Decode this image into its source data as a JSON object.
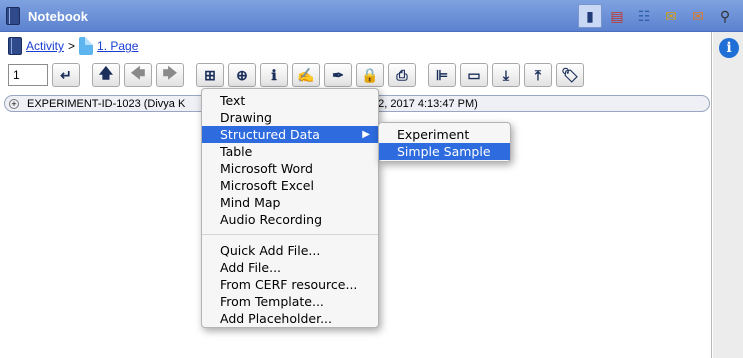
{
  "window": {
    "title": "Notebook"
  },
  "title_icons": [
    {
      "name": "notebook-view-icon",
      "glyph": "▮",
      "color": "#1f3b78"
    },
    {
      "name": "bookmark-page-icon",
      "glyph": "▤",
      "color": "#c0392b"
    },
    {
      "name": "table-list-icon",
      "glyph": "☷",
      "color": "#2e5fa8"
    },
    {
      "name": "envelope-icon",
      "glyph": "✉",
      "color": "#d4a017"
    },
    {
      "name": "open-envelope-icon",
      "glyph": "✉",
      "color": "#e07a1f"
    },
    {
      "name": "binoculars-icon",
      "glyph": "⚲",
      "color": "#333333"
    }
  ],
  "breadcrumb": {
    "activity": "Activity",
    "separator": ">",
    "page": "1. Page"
  },
  "toolbar": {
    "page_number": "1"
  },
  "entry": {
    "text": "EXPERIMENT-ID-1023 (Divya K",
    "suffix": "12, 2017 4:13:47 PM)"
  },
  "menu": {
    "items_group1": [
      "Text",
      "Drawing",
      "Structured Data",
      "Table",
      "Microsoft Word",
      "Microsoft Excel",
      "Mind Map",
      "Audio Recording"
    ],
    "items_group2": [
      "Quick Add File...",
      "Add File...",
      "From CERF resource...",
      "From Template...",
      "Add Placeholder..."
    ],
    "submenu_arrow": "▶"
  },
  "submenu": {
    "items": [
      "Experiment",
      "Simple Sample"
    ]
  },
  "info_glyph": "i"
}
